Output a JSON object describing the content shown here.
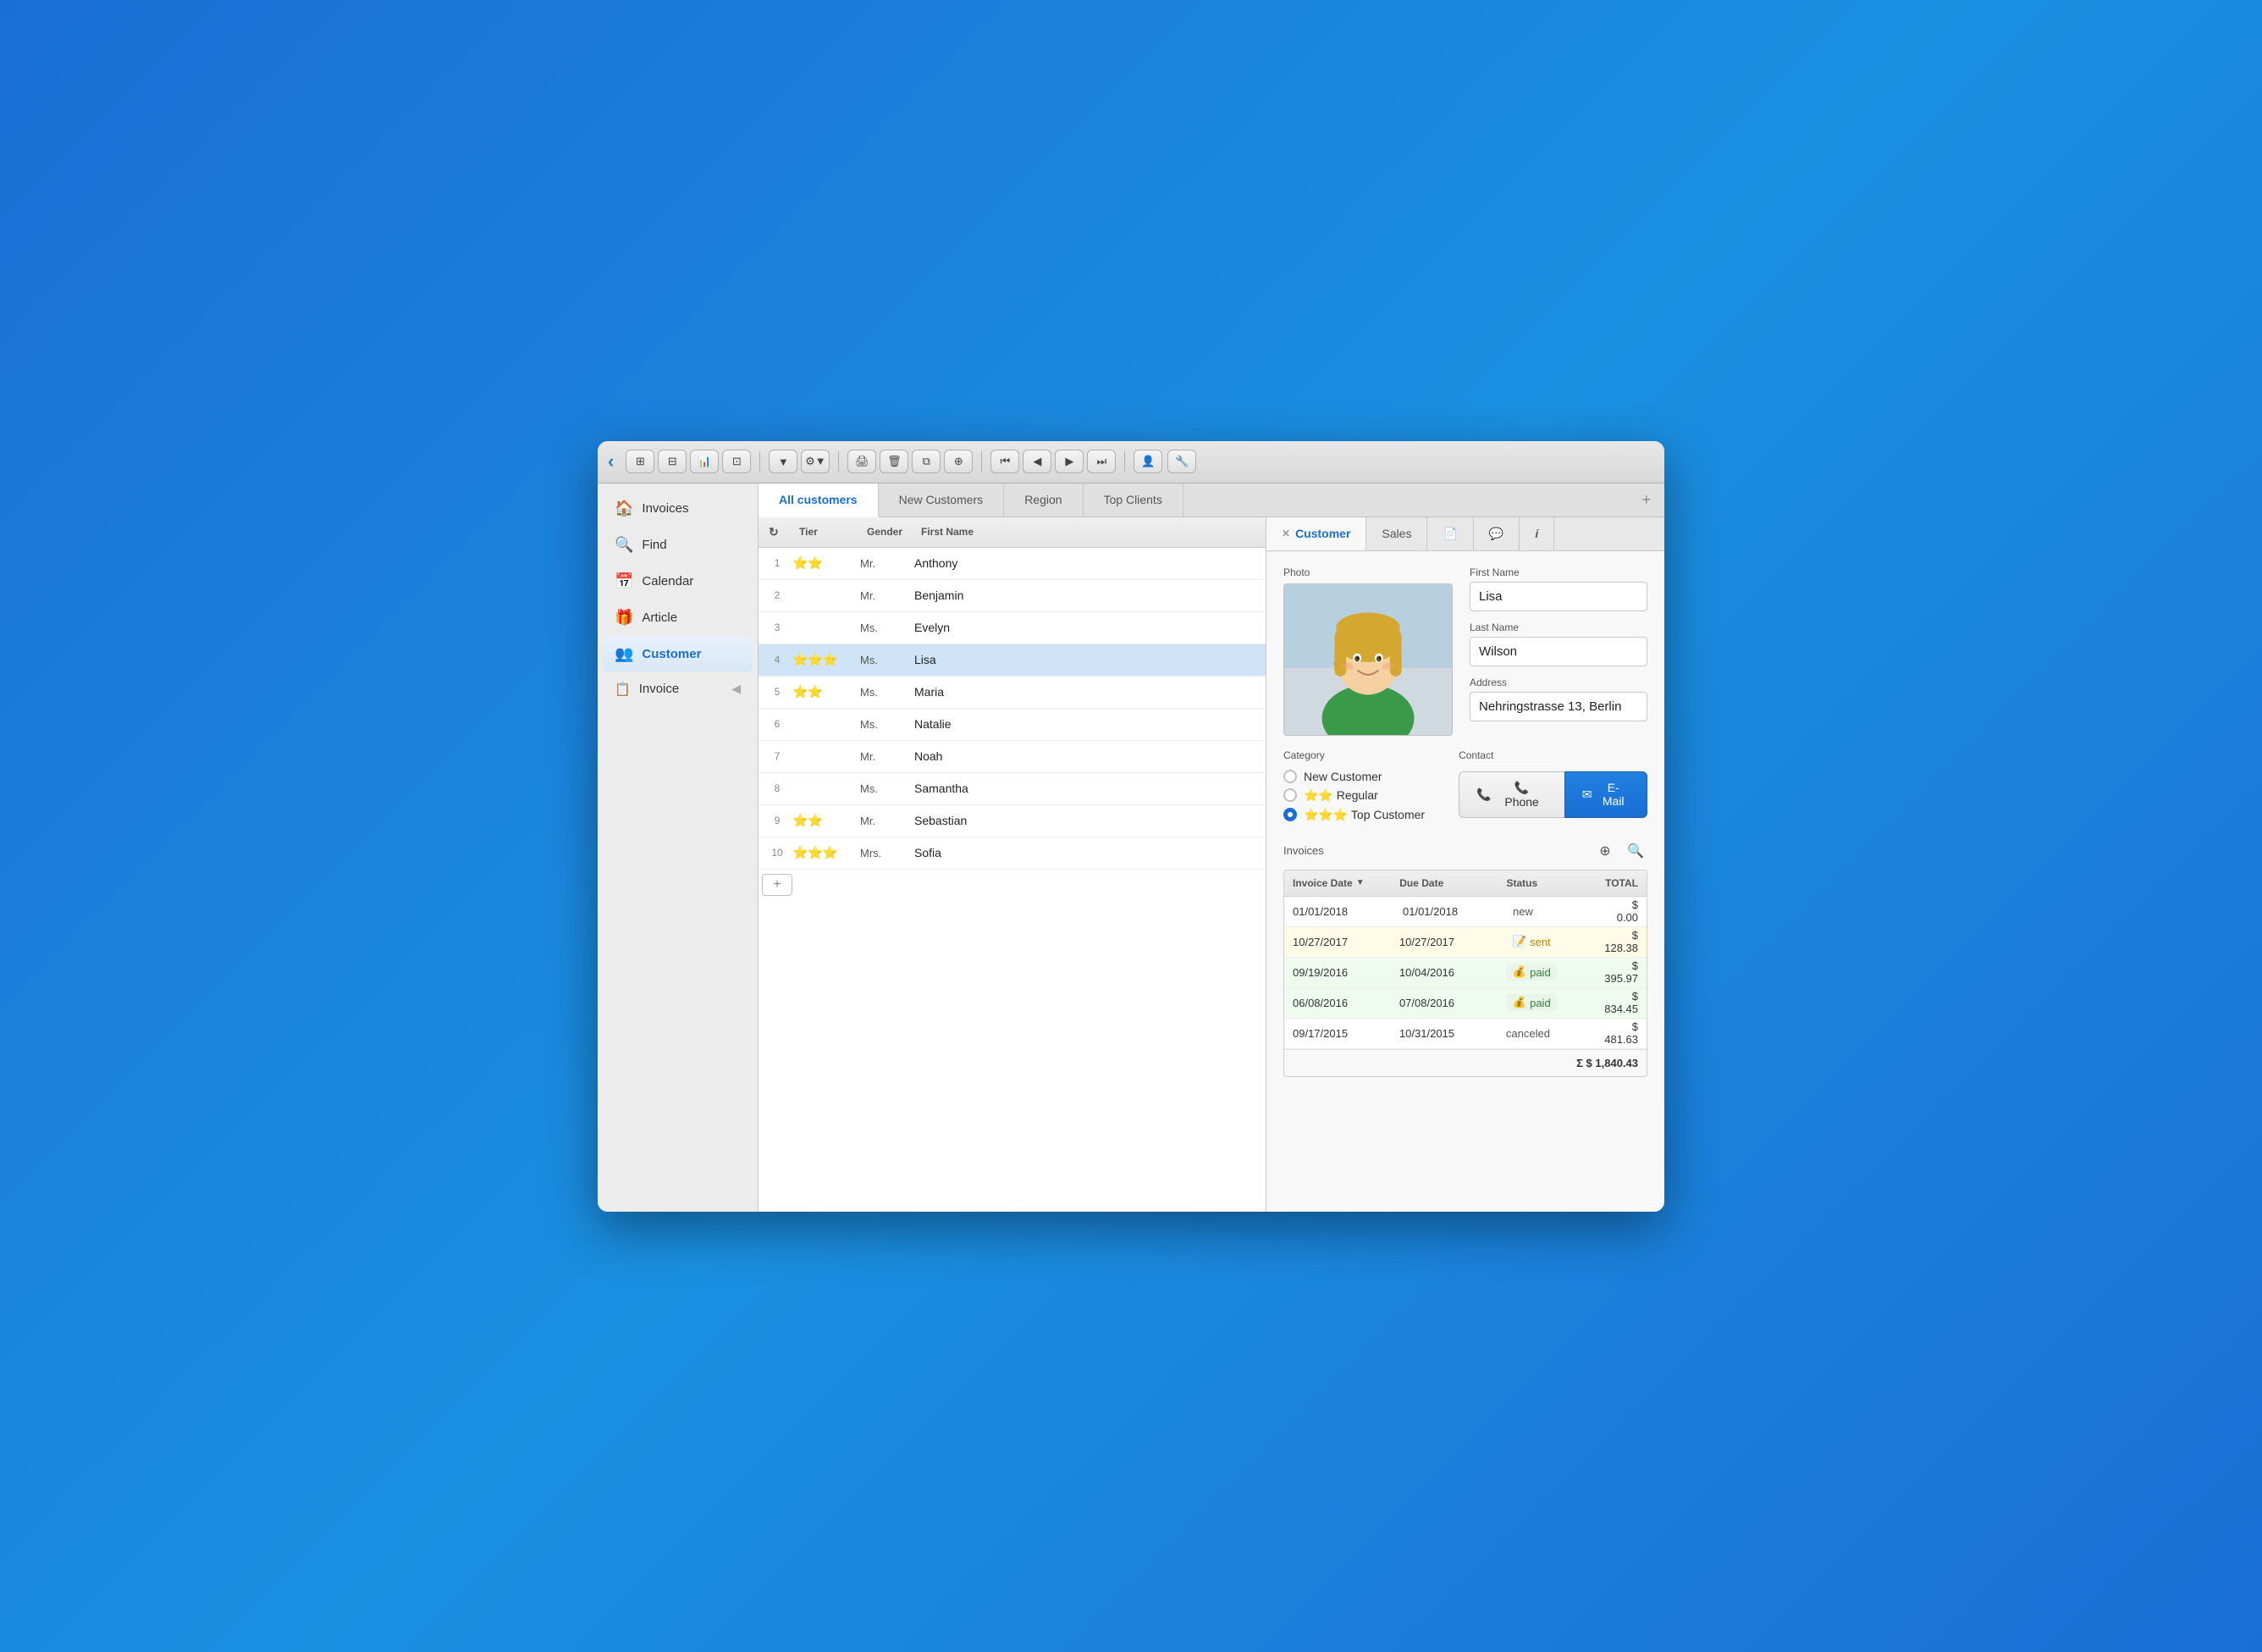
{
  "toolbar": {
    "back_label": "‹",
    "buttons": [
      "⊞",
      "⊟",
      "📊",
      "⊡",
      "▼",
      "⚙",
      "▼",
      "🖨",
      "🗑",
      "⧉",
      "⊕"
    ],
    "nav_buttons": [
      "⏮",
      "◀",
      "▶",
      "⏭"
    ],
    "user_icon": "👤",
    "wrench_icon": "🔧"
  },
  "sidebar": {
    "items": [
      {
        "id": "invoices",
        "icon": "🏠",
        "label": "Invoices"
      },
      {
        "id": "find",
        "icon": "🔍",
        "label": "Find"
      },
      {
        "id": "calendar",
        "icon": "📅",
        "label": "Calendar"
      },
      {
        "id": "article",
        "icon": "🎁",
        "label": "Article"
      },
      {
        "id": "customer",
        "icon": "👥",
        "label": "Customer"
      },
      {
        "id": "invoice",
        "icon": "📋",
        "label": "Invoice"
      }
    ]
  },
  "tabs": [
    {
      "id": "all",
      "label": "All customers",
      "active": true
    },
    {
      "id": "new",
      "label": "New Customers"
    },
    {
      "id": "region",
      "label": "Region"
    },
    {
      "id": "top",
      "label": "Top Clients"
    }
  ],
  "list": {
    "columns": [
      "Tier",
      "Gender",
      "First Name"
    ],
    "rows": [
      {
        "num": 1,
        "tier": "⭐⭐",
        "gender": "Mr.",
        "name": "Anthony",
        "selected": false
      },
      {
        "num": 2,
        "tier": "",
        "gender": "Mr.",
        "name": "Benjamin",
        "selected": false
      },
      {
        "num": 3,
        "tier": "",
        "gender": "Ms.",
        "name": "Evelyn",
        "selected": false
      },
      {
        "num": 4,
        "tier": "⭐⭐⭐",
        "gender": "Ms.",
        "name": "Lisa",
        "selected": true
      },
      {
        "num": 5,
        "tier": "⭐⭐",
        "gender": "Ms.",
        "name": "Maria",
        "selected": false
      },
      {
        "num": 6,
        "tier": "",
        "gender": "Ms.",
        "name": "Natalie",
        "selected": false
      },
      {
        "num": 7,
        "tier": "",
        "gender": "Mr.",
        "name": "Noah",
        "selected": false
      },
      {
        "num": 8,
        "tier": "",
        "gender": "Ms.",
        "name": "Samantha",
        "selected": false
      },
      {
        "num": 9,
        "tier": "⭐⭐",
        "gender": "Mr.",
        "name": "Sebastian",
        "selected": false
      },
      {
        "num": 10,
        "tier": "⭐⭐⭐",
        "gender": "Mrs.",
        "name": "Sofia",
        "selected": false
      }
    ]
  },
  "detail_tabs": [
    {
      "id": "customer",
      "label": "Customer",
      "active": true,
      "closable": true
    },
    {
      "id": "sales",
      "label": "Sales"
    },
    {
      "id": "doc",
      "label": "📄"
    },
    {
      "id": "chat",
      "label": "💬"
    },
    {
      "id": "info",
      "label": "i"
    }
  ],
  "customer": {
    "photo_label": "Photo",
    "first_name_label": "First Name",
    "first_name": "Lisa",
    "last_name_label": "Last Name",
    "last_name": "Wilson",
    "address_label": "Address",
    "address": "Nehringstrasse 13, Berlin",
    "category_label": "Category",
    "categories": [
      {
        "label": "New Customer",
        "selected": false
      },
      {
        "label": "⭐⭐ Regular",
        "selected": false
      },
      {
        "label": "⭐⭐⭐ Top Customer",
        "selected": true
      }
    ],
    "contact_label": "Contact",
    "phone_btn": "📞 Phone",
    "email_btn": "✉ E-Mail",
    "invoices_label": "Invoices",
    "invoices_columns": [
      "Invoice Date",
      "Due Date",
      "Status",
      "TOTAL"
    ],
    "invoices": [
      {
        "date": "01/01/2018",
        "due": "01/01/2018",
        "status": "new",
        "status_type": "new",
        "total": "$ 0.00"
      },
      {
        "date": "10/27/2017",
        "due": "10/27/2017",
        "status": "sent",
        "status_type": "sent",
        "total": "$ 128.38"
      },
      {
        "date": "09/19/2016",
        "due": "10/04/2016",
        "status": "paid",
        "status_type": "paid",
        "total": "$ 395.97"
      },
      {
        "date": "06/08/2016",
        "due": "07/08/2016",
        "status": "paid",
        "status_type": "paid",
        "total": "$ 834.45"
      },
      {
        "date": "09/17/2015",
        "due": "10/31/2015",
        "status": "canceled",
        "status_type": "cancelled",
        "total": "$ 481.63"
      }
    ],
    "invoices_total": "Σ $ 1,840.43"
  }
}
